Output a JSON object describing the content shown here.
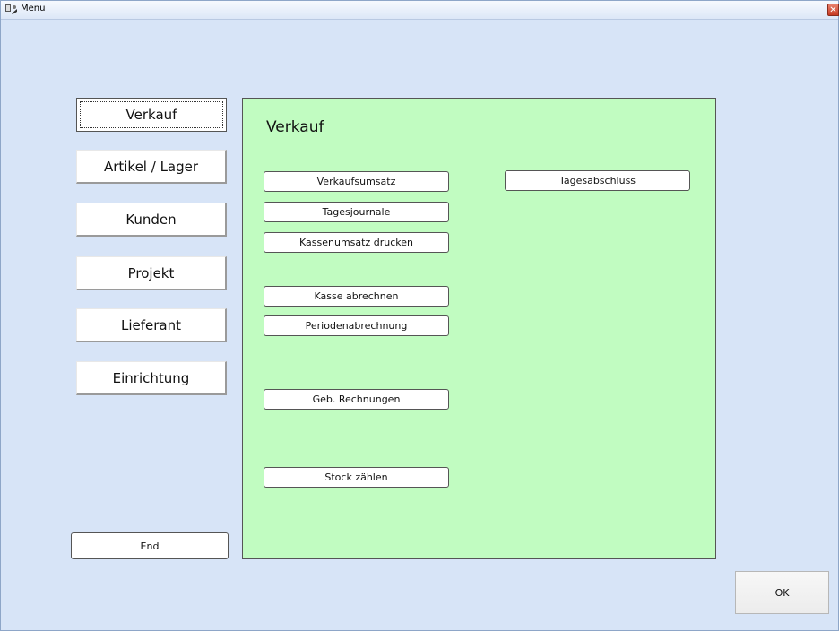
{
  "window": {
    "title": "Menu",
    "close_glyph": "✕"
  },
  "sidebar": {
    "items": [
      {
        "label": "Verkauf",
        "active": true
      },
      {
        "label": "Artikel / Lager"
      },
      {
        "label": "Kunden"
      },
      {
        "label": "Projekt"
      },
      {
        "label": "Lieferant"
      },
      {
        "label": "Einrichtung"
      }
    ],
    "end_label": "End"
  },
  "panel": {
    "title": "Verkauf",
    "background": "#c1fcc1",
    "buttons": {
      "verkaufsumsatz": "Verkaufsumsatz",
      "tagesabschluss": "Tagesabschluss",
      "tagesjournale": "Tagesjournale",
      "kassenumsatz": "Kassenumsatz drucken",
      "kasse_abrechnen": "Kasse abrechnen",
      "periodenabrechnung": "Periodenabrechnung",
      "geb_rechnungen": "Geb. Rechnungen",
      "stock_zaehlen": "Stock zählen"
    }
  },
  "footer": {
    "ok_label": "OK"
  },
  "colors": {
    "window_bg": "#d7e4f7",
    "panel_bg": "#c1fcc1"
  }
}
